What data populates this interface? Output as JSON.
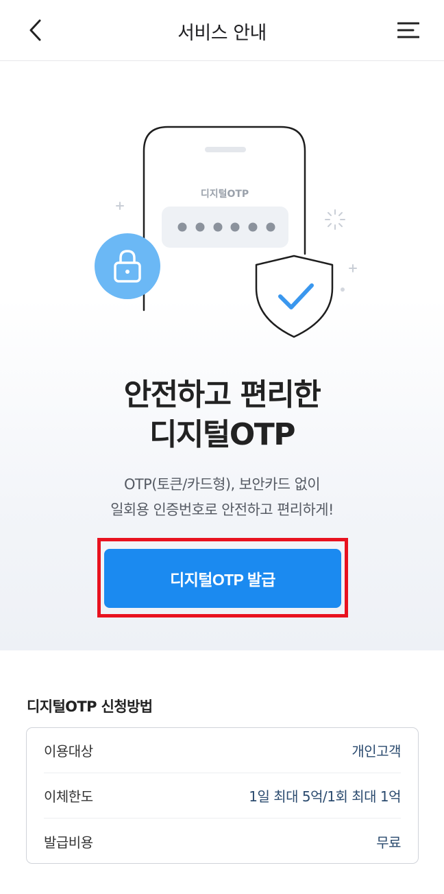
{
  "header": {
    "title": "서비스 안내",
    "back_icon": "chevron-left-icon",
    "menu_icon": "hamburger-menu-icon"
  },
  "hero": {
    "phone_label": "디지털OTP",
    "headline_line1": "안전하고 편리한",
    "headline_line2": "디지털OTP",
    "subtext_line1": "OTP(토큰/카드형), 보안카드 없이",
    "subtext_line2": "일회용 인증번호로 안전하고 편리하게!",
    "issue_button_label": "디지털OTP 발급"
  },
  "colors": {
    "accent": "#1b8af0",
    "highlight": "#e8121f",
    "lock_circle": "#6bb8f5",
    "check": "#3a97ee"
  },
  "info": {
    "section_title": "디지털OTP 신청방법",
    "rows": [
      {
        "label": "이용대상",
        "value": "개인고객"
      },
      {
        "label": "이체한도",
        "value": "1일 최대 5억/1회 최대 1억"
      },
      {
        "label": "발급비용",
        "value": "무료"
      }
    ]
  }
}
